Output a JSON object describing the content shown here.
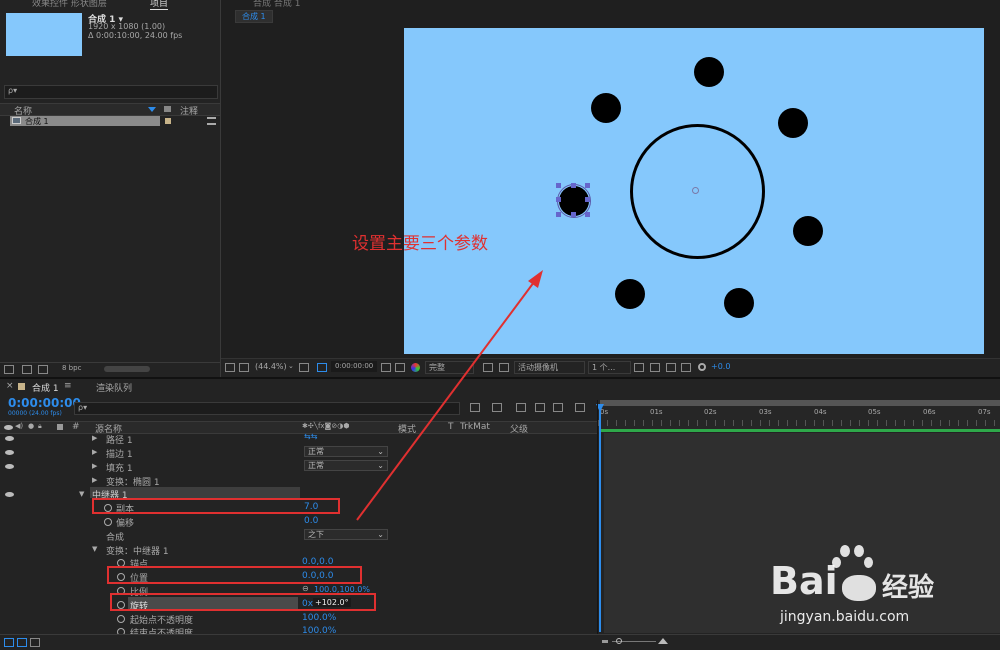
{
  "project": {
    "top_labels": [
      "效果控件 形状图层",
      "项目"
    ],
    "comp_name": "合成 1 ▾",
    "comp_size": "1920 x 1080 (1.00)",
    "comp_duration": "Δ 0:00:10:00, 24.00 fps",
    "search_placeholder": "ρ▾",
    "col_name": "名称",
    "col_comment": "注释",
    "item_name": "合成 1",
    "bpc": "8 bpc"
  },
  "viewer": {
    "top_label": "合成 合成 1",
    "tab": "合成 1",
    "overlay_text": "设置主要三个参数",
    "zoom": "(44.4%)",
    "time": "0:00:00:00",
    "quality": "完整",
    "camera": "活动摄像机",
    "views": "1 个...",
    "exposure": "+0.0"
  },
  "timeline": {
    "tab_label": "合成 1",
    "render_queue": "渲染队列",
    "timecode": "0:00:00:00",
    "frames": "00000 (24.00 fps)",
    "col_source": "源名称",
    "col_mode": "模式",
    "col_t": "T",
    "col_trkmat": "TrkMat",
    "col_parent": "父级",
    "ruler": [
      "0s",
      "01s",
      "02s",
      "03s",
      "04s",
      "05s",
      "06s",
      "07s"
    ],
    "rows": [
      {
        "label": "路径 1",
        "value": ""
      },
      {
        "label": "描边 1",
        "value": "正常"
      },
      {
        "label": "填充 1",
        "value": "正常"
      },
      {
        "label": "变换：椭圆 1",
        "value": ""
      },
      {
        "label": "中继器 1",
        "value": ""
      },
      {
        "label": "副本",
        "value": "7.0"
      },
      {
        "label": "偏移",
        "value": "0.0"
      },
      {
        "label": "合成",
        "value": "之下"
      },
      {
        "label": "变换：中继器 1",
        "value": ""
      },
      {
        "label": "锚点",
        "value": "0.0,0.0"
      },
      {
        "label": "位置",
        "value": "0.0,0.0"
      },
      {
        "label": "比例",
        "value": "100.0,100.0%"
      },
      {
        "label": "旋转",
        "value_prefix": "0x",
        "value": "+102.0°"
      },
      {
        "label": "起始点不透明度",
        "value": "100.0%"
      },
      {
        "label": "结束点不透明度",
        "value": "100.0%"
      }
    ]
  },
  "watermark": {
    "brand": "Bai",
    "brand2": "经验",
    "url": "jingyan.baidu.com"
  },
  "colors": {
    "canvas": "#85c8fc",
    "accent": "#2d8ceb",
    "annotation": "#e03030"
  }
}
